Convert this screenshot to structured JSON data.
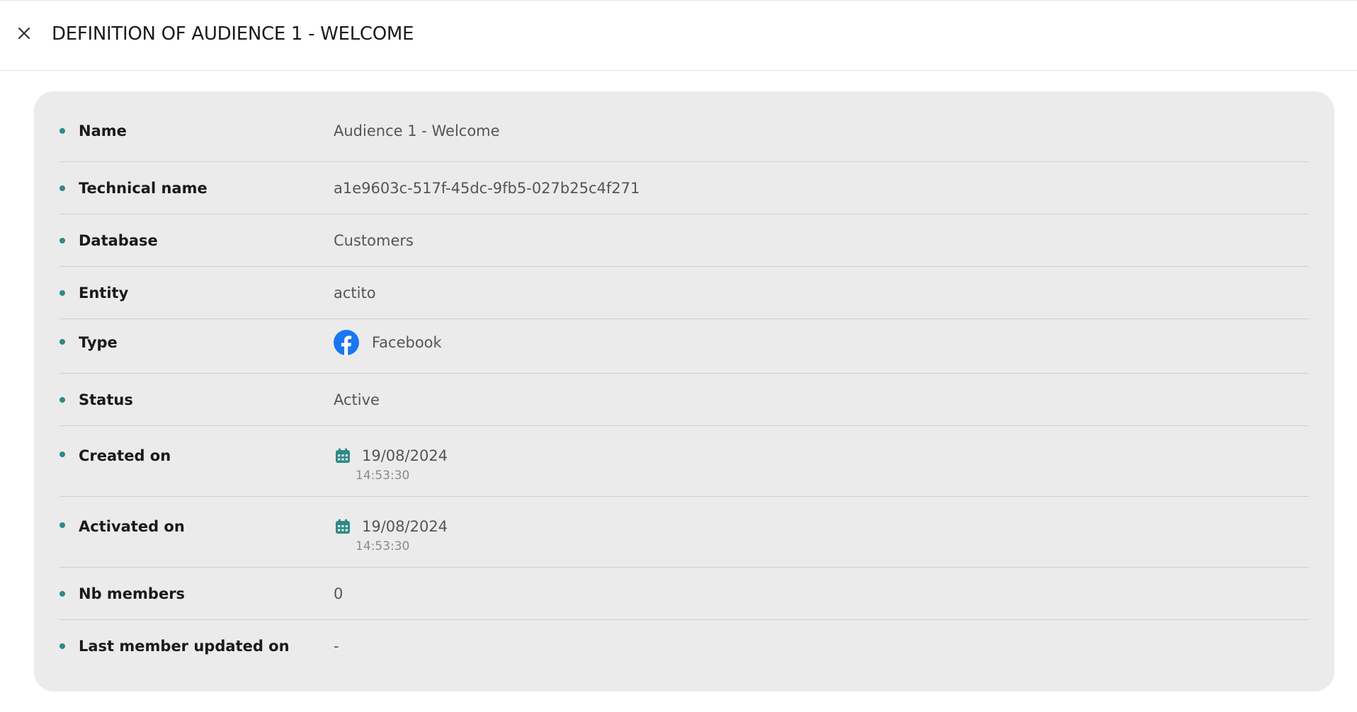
{
  "header": {
    "title": "DEFINITION OF AUDIENCE 1 - WELCOME",
    "close_icon": "close-icon"
  },
  "colors": {
    "bullet": "#2e8a88",
    "facebook": "#1877f2",
    "calendar": "#2e8a88",
    "card_bg": "#ebebeb"
  },
  "fields": {
    "name": {
      "label": "Name",
      "value": "Audience 1 - Welcome"
    },
    "technical_name": {
      "label": "Technical name",
      "value": "a1e9603c-517f-45dc-9fb5-027b25c4f271"
    },
    "database": {
      "label": "Database",
      "value": "Customers"
    },
    "entity": {
      "label": "Entity",
      "value": "actito"
    },
    "type": {
      "label": "Type",
      "value": "Facebook",
      "icon": "facebook-icon"
    },
    "status": {
      "label": "Status",
      "value": "Active"
    },
    "created_on": {
      "label": "Created on",
      "date": "19/08/2024",
      "time": "14:53:30",
      "icon": "calendar-icon"
    },
    "activated_on": {
      "label": "Activated on",
      "date": "19/08/2024",
      "time": "14:53:30",
      "icon": "calendar-icon"
    },
    "nb_members": {
      "label": "Nb members",
      "value": "0"
    },
    "last_member_updated_on": {
      "label": "Last member updated on",
      "value": "-"
    }
  }
}
